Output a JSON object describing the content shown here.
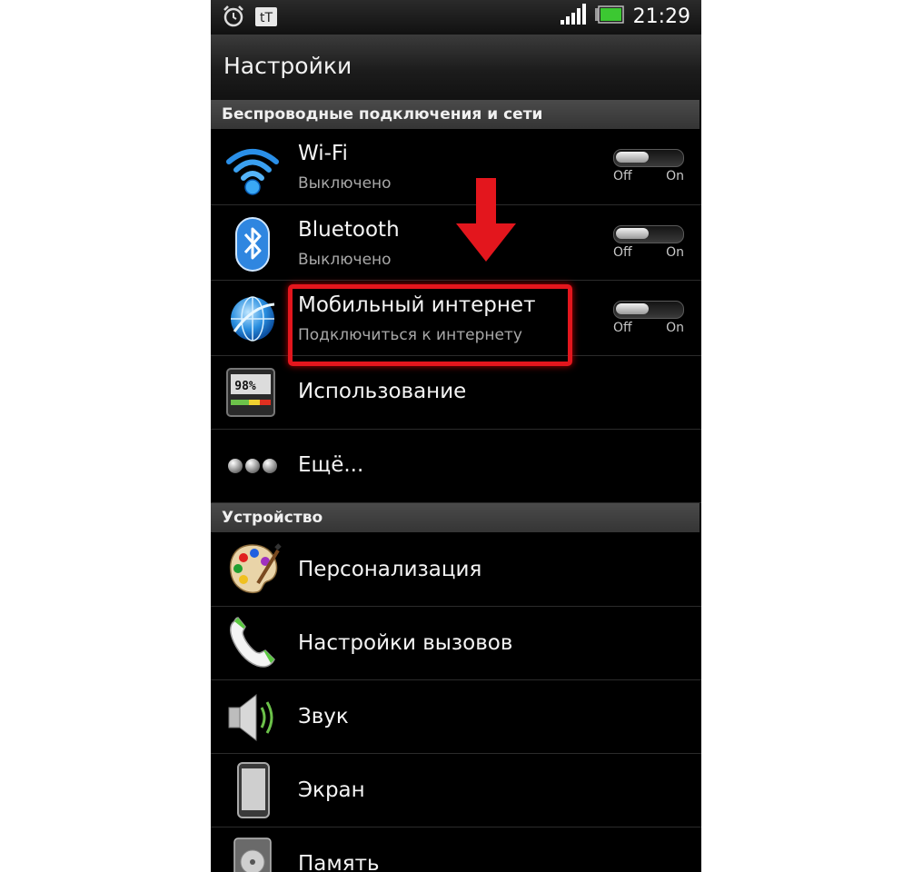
{
  "status_bar": {
    "time": "21:29",
    "notification_text": "tT"
  },
  "title_bar": {
    "title": "Настройки"
  },
  "sections": [
    {
      "label": "Беспроводные подключения и сети"
    },
    {
      "label": "Устройство"
    }
  ],
  "wireless": {
    "wifi": {
      "title": "Wi-Fi",
      "subtitle": "Выключено",
      "toggle_off": "Off",
      "toggle_on": "On"
    },
    "bluetooth": {
      "title": "Bluetooth",
      "subtitle": "Выключено",
      "toggle_off": "Off",
      "toggle_on": "On"
    },
    "mobile_internet": {
      "title": "Мобильный интернет",
      "subtitle": "Подключиться к интернету",
      "toggle_off": "Off",
      "toggle_on": "On"
    },
    "usage": {
      "title": "Использование",
      "icon_text": "98%"
    },
    "more": {
      "title": "Ещё..."
    }
  },
  "device": {
    "personalization": {
      "title": "Персонализация"
    },
    "call_settings": {
      "title": "Настройки вызовов"
    },
    "sound": {
      "title": "Звук"
    },
    "display": {
      "title": "Экран"
    },
    "memory": {
      "title": "Память"
    }
  },
  "colors": {
    "annotation_red": "#e3161d",
    "battery_green": "#3cc832",
    "usage_gauge_green": "#6cc24a"
  },
  "icons": [
    "alarm-clock-icon",
    "notification-icon",
    "signal-icon",
    "battery-icon",
    "wifi-icon",
    "bluetooth-icon",
    "globe-icon",
    "usage-gauge-icon",
    "more-dots-icon",
    "palette-icon",
    "phone-handset-icon",
    "speaker-icon",
    "phone-screen-icon",
    "memory-disk-icon"
  ]
}
